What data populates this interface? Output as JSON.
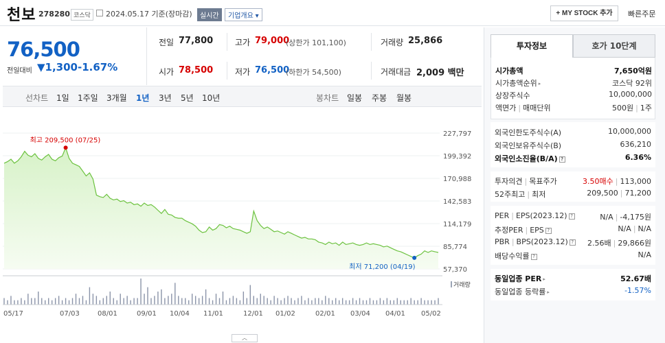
{
  "header": {
    "name": "천보",
    "code": "278280",
    "market_tag": "코스닥",
    "date_text": "2024.05.17  기준(장마감)",
    "realtime_btn": "실시간",
    "company_btn": "기업개요",
    "mystock_btn": "+ MY STOCK 추가",
    "quick_order": "빠른주문"
  },
  "price": {
    "current": "76,500",
    "change_label": "전일대비",
    "change_value": "▼1,300",
    "change_pct": "-1.67%"
  },
  "quotes": {
    "prev_label": "전일",
    "prev_value": "77,800",
    "high_label": "고가",
    "high_value": "79,000",
    "upper_limit": "(상한가 101,100)",
    "volume_label": "거래량",
    "volume_value": "25,866",
    "open_label": "시가",
    "open_value": "78,500",
    "low_label": "저가",
    "low_value": "76,500",
    "lower_limit": "(하한가 54,500)",
    "amount_label": "거래대금",
    "amount_value": "2,009 백만"
  },
  "period_bar": {
    "line_label": "선차트",
    "line_items": [
      "1일",
      "1주일",
      "3개월",
      "1년",
      "3년",
      "5년",
      "10년"
    ],
    "active": "1년",
    "candle_label": "봉차트",
    "candle_items": [
      "일봉",
      "주봉",
      "월봉"
    ]
  },
  "chart_data": {
    "type": "area",
    "y_ticks": [
      "227,797",
      "199,392",
      "170,988",
      "142,583",
      "114,179",
      "85,774",
      "57,370"
    ],
    "ylim": [
      57370,
      227797
    ],
    "x_ticks": [
      "05/17",
      "07/03",
      "08/01",
      "09/01",
      "10/04",
      "11/01",
      "12/01",
      "01/02",
      "02/01",
      "03/04",
      "04/01",
      "05/02"
    ],
    "high_annotation": "최고 209,500 (07/25)",
    "low_annotation": "최저 71,200 (04/19)",
    "volume_label": "거래량",
    "series": [
      {
        "values": [
          190000,
          192000,
          195000,
          190000,
          193000,
          198000,
          205000,
          200000,
          198000,
          202000,
          196000,
          194000,
          198000,
          201000,
          195000,
          193000,
          197000,
          199000,
          209500,
          196000,
          190000,
          188000,
          186000,
          180000,
          174000,
          178000,
          170000,
          150000,
          148000,
          147000,
          151000,
          146000,
          144000,
          145000,
          142000,
          143000,
          140000,
          141000,
          138000,
          139000,
          136000,
          140000,
          137000,
          138000,
          135000,
          131000,
          127000,
          132000,
          126000,
          125000,
          122000,
          121000,
          121000,
          118000,
          116000,
          114000,
          111000,
          106000,
          103000,
          104000,
          110000,
          106000,
          108000,
          113000,
          112000,
          109000,
          111000,
          108000,
          107000,
          106000,
          104000,
          102000,
          104000,
          130000,
          118000,
          112000,
          108000,
          110000,
          107000,
          104000,
          105000,
          103000,
          101000,
          104000,
          102000,
          100000,
          98000,
          96000,
          97000,
          95000,
          95000,
          94000,
          91000,
          90000,
          88000,
          91000,
          89000,
          90000,
          87000,
          91000,
          88000,
          89000,
          90000,
          88000,
          87000,
          88000,
          90000,
          88000,
          89000,
          88000,
          87000,
          85000,
          86000,
          84000,
          82000,
          80000,
          79000,
          77000,
          75000,
          73000,
          71200,
          74000,
          76000,
          80000,
          78000,
          80000,
          79000,
          78000
        ]
      }
    ],
    "volume": [
      3,
      2,
      4,
      2,
      2,
      3,
      2,
      5,
      3,
      3,
      6,
      3,
      2,
      3,
      2,
      3,
      4,
      2,
      3,
      2,
      3,
      5,
      3,
      4,
      2,
      8,
      5,
      4,
      2,
      3,
      4,
      6,
      3,
      2,
      5,
      3,
      4,
      2,
      3,
      3,
      12,
      5,
      8,
      3,
      4,
      6,
      7,
      3,
      4,
      5,
      10,
      4,
      3,
      3,
      2,
      5,
      4,
      3,
      4,
      7,
      3,
      2,
      5,
      3,
      6,
      2,
      3,
      4,
      3,
      2,
      6,
      3,
      9,
      4,
      3,
      5,
      4,
      3,
      2,
      4,
      3,
      2,
      3,
      4,
      3,
      2,
      3,
      4,
      2,
      3,
      2,
      3,
      3,
      2,
      4,
      3,
      2,
      3,
      2,
      3,
      2,
      2,
      3,
      2,
      3,
      2,
      2,
      3,
      2,
      2,
      3,
      2,
      3,
      2,
      2,
      3,
      2,
      2,
      2,
      3,
      2,
      2,
      3,
      2,
      2,
      2,
      2,
      3
    ]
  },
  "side_tabs": {
    "active": "투자정보",
    "other": "호가 10단계"
  },
  "info": {
    "market_cap_label": "시가총액",
    "market_cap_value": "7,650억원",
    "rank_label": "시가총액순위",
    "rank_value": "코스닥 92위",
    "shares_label": "상장주식수",
    "shares_value": "10,000,000",
    "par_label": "액면가",
    "par_sep": "매매단위",
    "par_value": "500원",
    "unit_value": "1주",
    "foreign_limit_label": "외국인한도주식수(A)",
    "foreign_limit_value": "10,000,000",
    "foreign_hold_label": "외국인보유주식수(B)",
    "foreign_hold_value": "636,210",
    "foreign_ratio_label": "외국인소진율(B/A)",
    "foreign_ratio_value": "6.36%",
    "opinion_label": "투자의견",
    "target_label": "목표주가",
    "opinion_value": "3.50매수",
    "target_value": "113,000",
    "w52_label": "52주최고",
    "w52_low_label": "최저",
    "w52_high_value": "209,500",
    "w52_low_value": "71,200",
    "per_label": "PER",
    "eps_label": "EPS(2023.12)",
    "per_value": "N/A",
    "eps_value": "-4,175원",
    "est_per_label": "추정PER",
    "est_eps_label": "EPS",
    "est_per_value": "N/A",
    "est_eps_value": "N/A",
    "pbr_label": "PBR",
    "bps_label": "BPS(2023.12)",
    "pbr_value": "2.56배",
    "bps_value": "29,866원",
    "div_label": "배당수익률",
    "div_value": "N/A",
    "ind_per_label": "동일업종 PER",
    "ind_per_value": "52.67배",
    "ind_rate_label": "동일업종 등락률",
    "ind_rate_value": "-1.57%"
  }
}
